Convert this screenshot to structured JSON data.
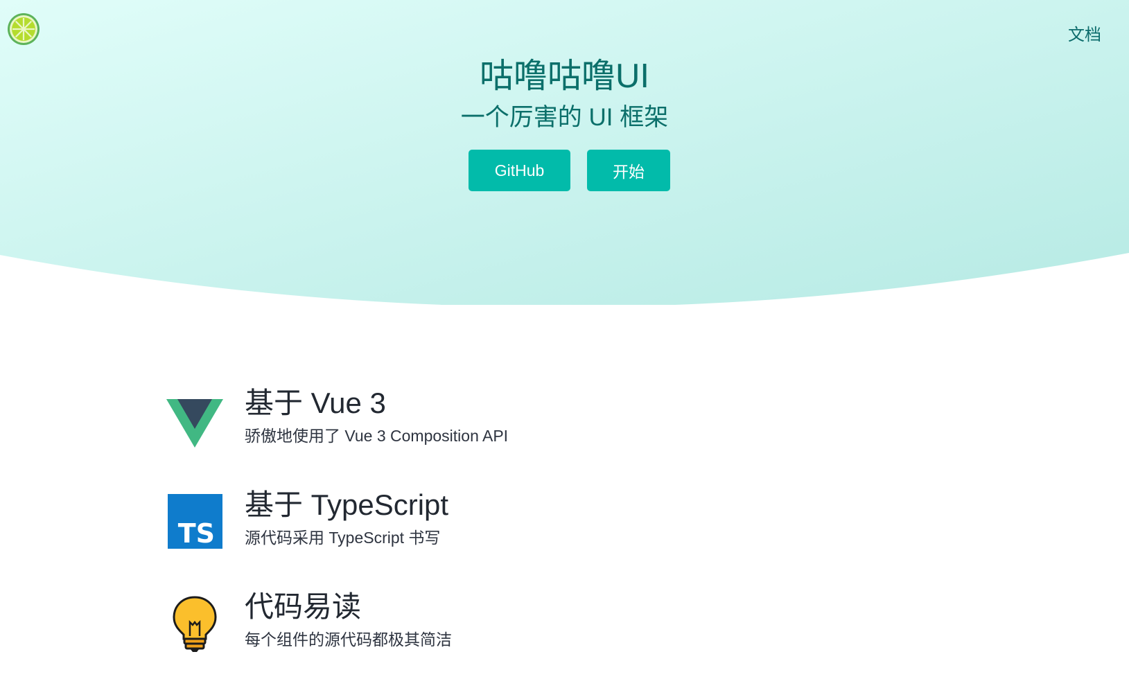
{
  "nav": {
    "logo_icon": "lime-slice-icon",
    "doc_link": "文档"
  },
  "hero": {
    "title": "咕噜咕噜UI",
    "subtitle": "一个厉害的 UI 框架",
    "buttons": {
      "github": "GitHub",
      "start": "开始"
    }
  },
  "features": [
    {
      "icon": "vue-logo-icon",
      "title": "基于 Vue 3",
      "desc": "骄傲地使用了 Vue 3 Composition API"
    },
    {
      "icon": "typescript-logo-icon",
      "title": "基于 TypeScript",
      "desc": "源代码采用 TypeScript 书写"
    },
    {
      "icon": "lightbulb-icon",
      "title": "代码易读",
      "desc": "每个组件的源代码都极其简洁"
    }
  ],
  "colors": {
    "accent": "#02bbaa",
    "hero_text": "#0b6f6a",
    "banner_left": "#dcfbf7",
    "banner_right": "#b9ece6"
  }
}
